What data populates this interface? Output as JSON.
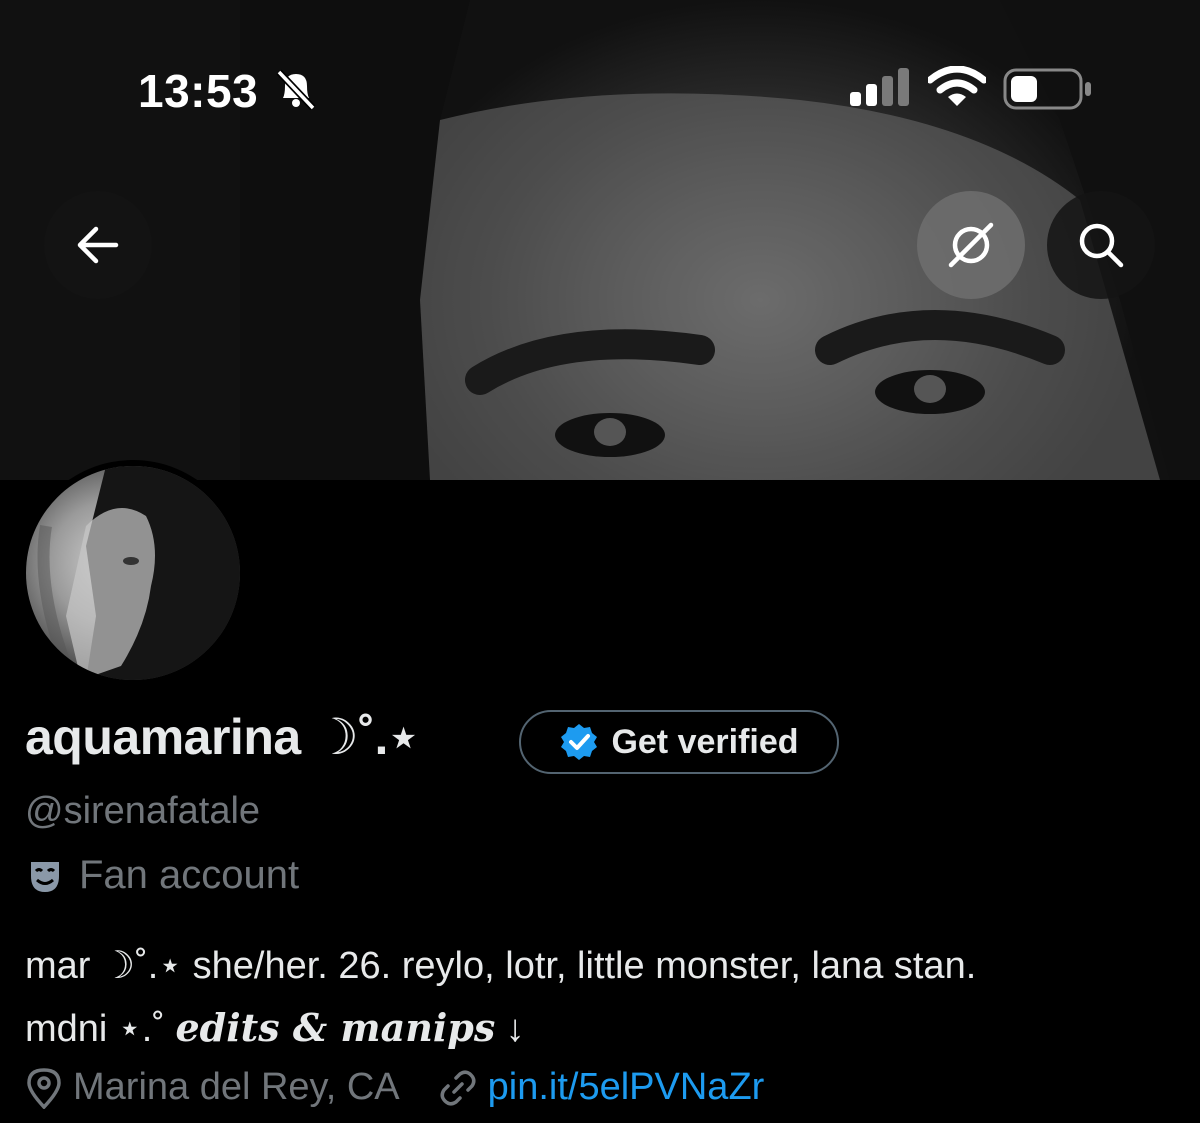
{
  "status_bar": {
    "time": "13:53",
    "icons": [
      "bell-slash-icon",
      "signal-icon",
      "wifi-icon",
      "battery-icon"
    ]
  },
  "header": {
    "back_icon": "arrow-left-icon",
    "grok_icon": "grok-icon",
    "search_icon": "search-icon"
  },
  "profile": {
    "display_name": "aquamarina ☽˚.⋆",
    "verify_button": "Get verified",
    "handle": "@sirenafatale",
    "category": "Fan account",
    "bio_line1": "mar ☽˚.⋆ she/her. 26. reylo, lotr, little monster, lana stan.",
    "bio_line2_prefix": "mdni ⋆.˚ ",
    "bio_fancy": "edits & manips",
    "bio_suffix": " ↓",
    "location": "Marina del Rey, CA",
    "link": "pin.it/5elPVNaZr"
  },
  "colors": {
    "accent": "#1d9bf0",
    "muted": "#71767b",
    "text": "#e7e9ea"
  }
}
